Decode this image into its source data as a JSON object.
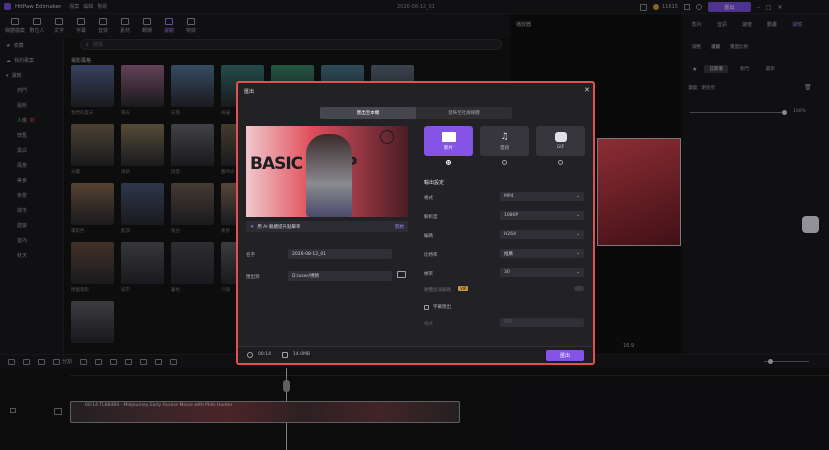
{
  "app": {
    "title": "HitPaw Edimaker",
    "menu": [
      "檔案",
      "編輯",
      "幫助"
    ],
    "doc_title": "2026-08-12_01",
    "credits": "11615",
    "export_label": "匯出"
  },
  "toolbar": {
    "items": [
      "媒體檔案",
      "數位人",
      "文字",
      "字幕",
      "音效",
      "素材",
      "轉場",
      "濾鏡",
      "特效"
    ]
  },
  "sidebar": {
    "groups": [
      "收藏",
      "我的專案",
      "濾鏡"
    ],
    "items": [
      "熱門",
      "最新",
      "人像",
      "電影風格",
      "懷舊",
      "黑白",
      "風景",
      "美食",
      "夜景",
      "城市",
      "建築",
      "室內",
      "秋天"
    ],
    "badge_new": "新"
  },
  "media": {
    "search_placeholder": "搜尋",
    "section": "電影風格",
    "captions": [
      "我們的夏天",
      "陽光",
      "日落",
      "海邊",
      "薄暮",
      "夢幻",
      "暖陽",
      "光暈",
      "清新",
      "街景",
      "舊時光",
      "電影色",
      "藍調",
      "復古",
      "黃昏",
      "懷舊電影",
      "城市",
      "暮色",
      "冷調",
      "人文紀實"
    ]
  },
  "player": {
    "title": "播放器",
    "zoom": "16:9"
  },
  "props": {
    "tabs": [
      "影片",
      "音訊",
      "速度",
      "動畫",
      "濾鏡"
    ],
    "subtabs": [
      "調整",
      "濾鏡",
      "畫面比例"
    ],
    "chips": [
      "已新增",
      "熱門",
      "最新"
    ],
    "filter_name": "濾鏡：明亮亮",
    "strength": "100%"
  },
  "timeline": {
    "split_label": "分割",
    "clip_label": "00:14 TL6B460 · Midjourney Early Access Movie with Phils Hunter",
    "duration": "00:14"
  },
  "dialog": {
    "title": "匯出",
    "tabs": [
      "匯出至本機",
      "發佈至社群媒體"
    ],
    "preview": {
      "title_text": "BASIC SHOP",
      "banner": "用 AI 繼續提升點擊率",
      "banner_action": "開始"
    },
    "name_label": "名字",
    "name_value": "2026-08-12_01",
    "path_label": "匯出到",
    "path_value": "D:/user/視頻",
    "formats": [
      "影片",
      "音訊",
      "GIF"
    ],
    "section": "輸出設定",
    "settings": [
      {
        "label": "格式",
        "value": "MP4"
      },
      {
        "label": "解析度",
        "value": "1080P"
      },
      {
        "label": "編碼",
        "value": "H264"
      },
      {
        "label": "比特率",
        "value": "推薦"
      },
      {
        "label": "幀率",
        "value": "30"
      }
    ],
    "hw_label": "硬體加速編碼",
    "hw_badge": "VIP",
    "subtitle_label": "字幕匯出",
    "subtitle_format_label": "格式",
    "subtitle_format_value": "SRT",
    "duration": "00:14",
    "size": "14.0MB",
    "export_button": "匯出"
  }
}
